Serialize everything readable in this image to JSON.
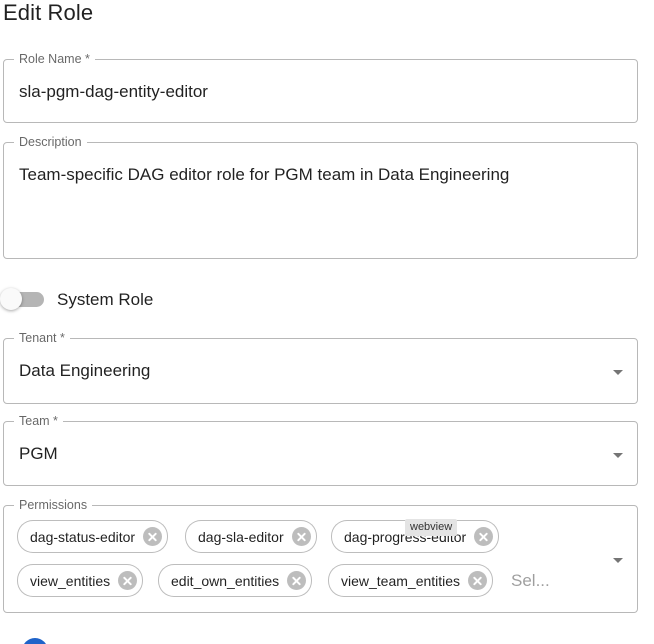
{
  "page": {
    "title": "Edit Role"
  },
  "role_name": {
    "label": "Role Name *",
    "value": "sla-pgm-dag-entity-editor"
  },
  "description": {
    "label": "Description",
    "value": "Team-specific DAG editor role for PGM team in Data Engineering"
  },
  "system_role": {
    "label": "System Role",
    "checked": false
  },
  "tenant": {
    "label": "Tenant *",
    "value": "Data Engineering"
  },
  "team": {
    "label": "Team *",
    "value": "PGM"
  },
  "permissions": {
    "label": "Permissions",
    "chips": [
      "dag-status-editor",
      "dag-sla-editor",
      "dag-progress-editor",
      "view_entities",
      "edit_own_entities",
      "view_team_entities"
    ],
    "placeholder": "Sel..."
  },
  "tooltip": {
    "text": "webview"
  },
  "colors": {
    "accent": "#1f63c9",
    "switch_track": "#b5b5b5"
  },
  "icons": {
    "chip_delete": "cancel-circle-icon",
    "dropdown": "arrow-drop-down-icon"
  }
}
